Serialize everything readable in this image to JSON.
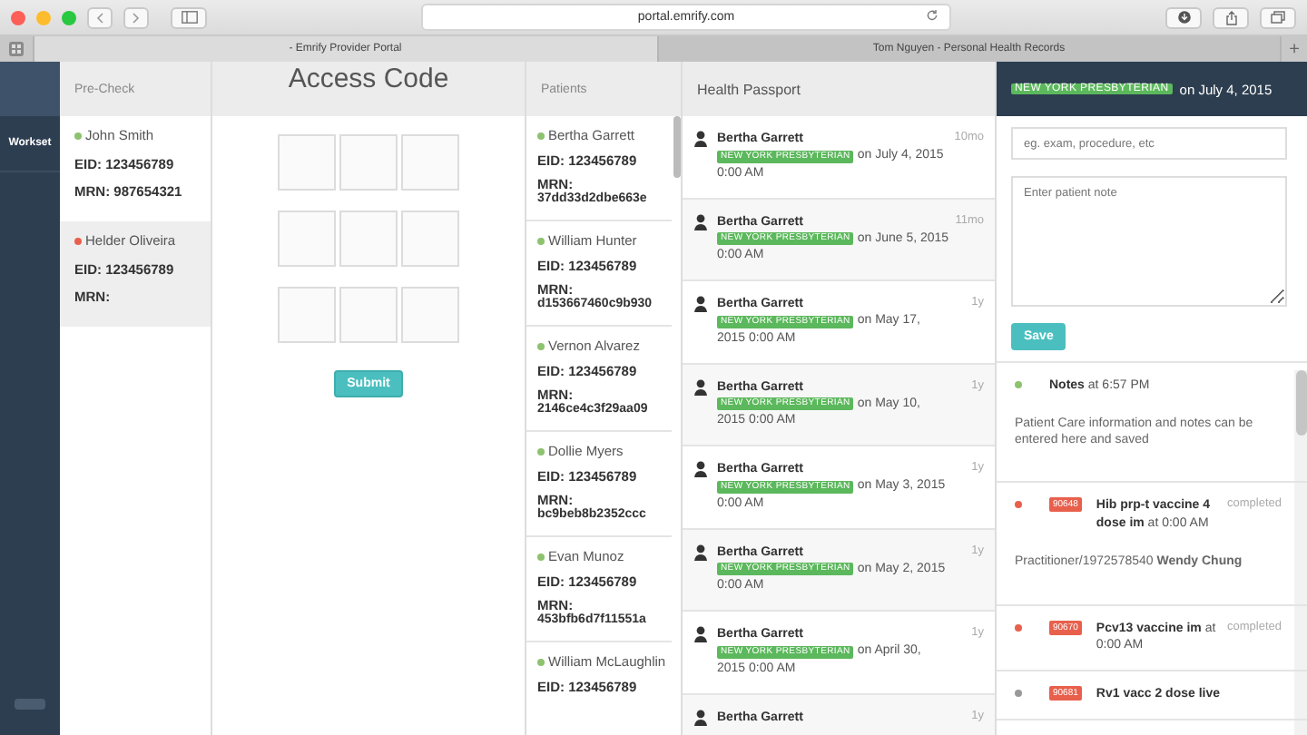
{
  "browser": {
    "url": "portal.emrify.com",
    "tabs": [
      {
        "label": "- Emrify Provider Portal",
        "selected": true
      },
      {
        "label": "Tom Nguyen - Personal Health Records",
        "selected": false
      }
    ],
    "new_tab": "+"
  },
  "sidebar": {
    "items": [
      {
        "label": "Workset"
      }
    ]
  },
  "precheck": {
    "title": "Pre-Check",
    "patients": [
      {
        "name": "John Smith",
        "color": "#8dc26f",
        "eid": "EID: 123456789",
        "mrn": "MRN: 987654321",
        "selected": false
      },
      {
        "name": "Helder Oliveira",
        "color": "#e8604c",
        "eid": "EID: 123456789",
        "mrn": "MRN:",
        "selected": true
      }
    ]
  },
  "access_code": {
    "title": "Access Code",
    "submit": "Submit"
  },
  "patients": {
    "title": "Patients",
    "items": [
      {
        "name": "Bertha Garrett",
        "color": "#8dc26f",
        "eid": "EID: 123456789",
        "mrn_label": "MRN:",
        "mrn": "37dd33d2dbe663e"
      },
      {
        "name": "William Hunter",
        "color": "#8dc26f",
        "eid": "EID: 123456789",
        "mrn_label": "MRN:",
        "mrn": "d153667460c9b930"
      },
      {
        "name": "Vernon Alvarez",
        "color": "#8dc26f",
        "eid": "EID: 123456789",
        "mrn_label": "MRN:",
        "mrn": "2146ce4c3f29aa09"
      },
      {
        "name": "Dollie Myers",
        "color": "#8dc26f",
        "eid": "EID: 123456789",
        "mrn_label": "MRN:",
        "mrn": "bc9beb8b2352ccc"
      },
      {
        "name": "Evan Munoz",
        "color": "#8dc26f",
        "eid": "EID: 123456789",
        "mrn_label": "MRN:",
        "mrn": "453bfb6d7f11551a"
      },
      {
        "name": "William McLaughlin",
        "color": "#8dc26f",
        "eid": "EID: 123456789"
      }
    ]
  },
  "health_passport": {
    "title": "Health Passport",
    "entries": [
      {
        "name": "Bertha Garrett",
        "age": "10mo",
        "badge": "NEW YORK PRESBYTERIAN",
        "date": "on July 4, 2015",
        "time": "0:00 AM"
      },
      {
        "name": "Bertha Garrett",
        "age": "11mo",
        "badge": "NEW YORK PRESBYTERIAN",
        "date": "on June 5, 2015",
        "time": "0:00 AM"
      },
      {
        "name": "Bertha Garrett",
        "age": "1y",
        "badge": "NEW YORK PRESBYTERIAN",
        "date": "on May 17,",
        "time": "2015 0:00 AM"
      },
      {
        "name": "Bertha Garrett",
        "age": "1y",
        "badge": "NEW YORK PRESBYTERIAN",
        "date": "on May 10,",
        "time": "2015 0:00 AM"
      },
      {
        "name": "Bertha Garrett",
        "age": "1y",
        "badge": "NEW YORK PRESBYTERIAN",
        "date": "on May 3, 2015",
        "time": "0:00 AM"
      },
      {
        "name": "Bertha Garrett",
        "age": "1y",
        "badge": "NEW YORK PRESBYTERIAN",
        "date": "on May 2, 2015",
        "time": "0:00 AM"
      },
      {
        "name": "Bertha Garrett",
        "age": "1y",
        "badge": "NEW YORK PRESBYTERIAN",
        "date": "on April 30,",
        "time": "2015 0:00 AM"
      },
      {
        "name": "Bertha Garrett",
        "age": "1y"
      }
    ]
  },
  "detail": {
    "header": {
      "badge": "NEW YORK PRESBYTERIAN",
      "date": "on July 4, 2015"
    },
    "title_field": {
      "placeholder": "eg. exam, procedure, etc"
    },
    "note_field": {
      "placeholder": "Enter patient note"
    },
    "save": "Save",
    "timeline": [
      {
        "kind": "note",
        "color": "#8dc26f",
        "heading": "**Notes** at 6:57 PM",
        "body": "Patient Care information and notes can be entered here and saved"
      },
      {
        "kind": "procedure",
        "color": "#e8604c",
        "code": "90648",
        "heading": "**Hib prp-t vaccine 4 dose im** at 0:00 AM",
        "status": "completed",
        "body": "Practitioner/1972578540 **Wendy Chung**"
      },
      {
        "kind": "procedure",
        "color": "#e8604c",
        "code": "90670",
        "heading": "**Pcv13 vaccine im** at 0:00 AM",
        "status": "completed"
      },
      {
        "kind": "procedure",
        "color": "#999999",
        "code": "90681",
        "heading": "**Rv1 vacc 2 dose live**"
      }
    ]
  }
}
